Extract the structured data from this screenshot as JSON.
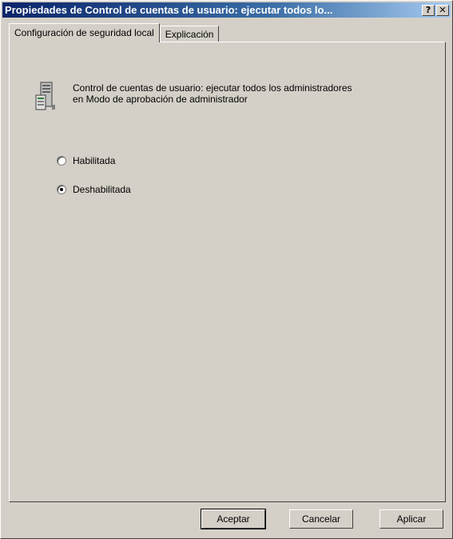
{
  "window": {
    "title": "Propiedades de Control de cuentas de usuario: ejecutar todos lo...",
    "help_glyph": "?",
    "close_glyph": "✕"
  },
  "tabs": [
    {
      "label": "Configuración de seguridad local",
      "active": true
    },
    {
      "label": "Explicación",
      "active": false
    }
  ],
  "policy": {
    "icon": "policy-server-icon",
    "line1": "Control de cuentas de usuario: ejecutar todos los administradores",
    "line2": "en Modo de aprobación de administrador"
  },
  "options": [
    {
      "label": "Habilitada",
      "selected": false
    },
    {
      "label": "Deshabilitada",
      "selected": true
    }
  ],
  "buttons": {
    "ok": "Aceptar",
    "cancel": "Cancelar",
    "apply": "Aplicar"
  },
  "colors": {
    "titlebar_start": "#0a246a",
    "face": "#d4d0c8"
  }
}
